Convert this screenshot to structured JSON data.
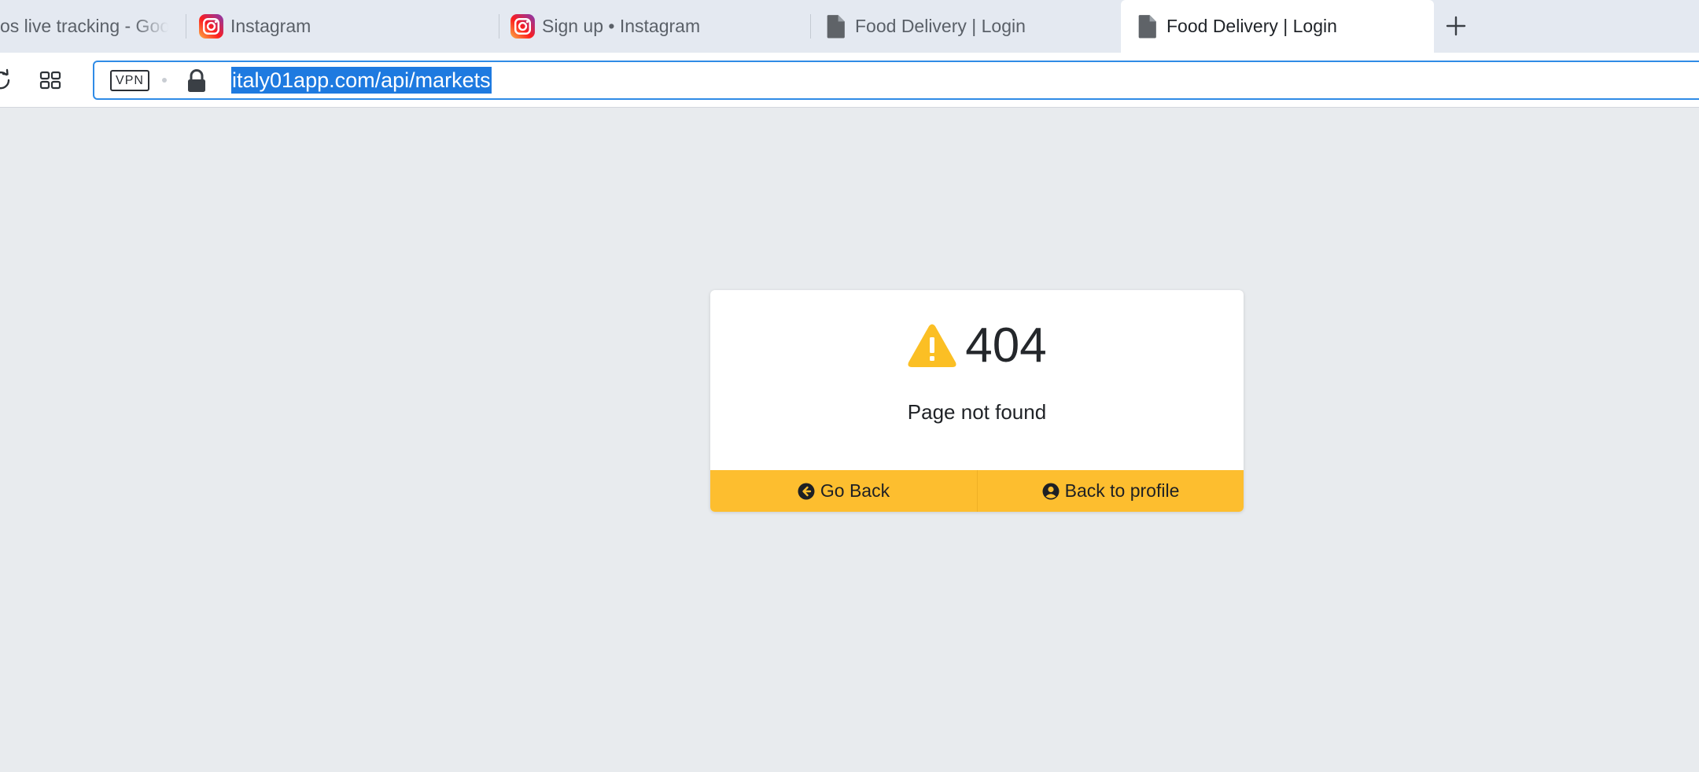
{
  "browser": {
    "tabs": [
      {
        "label": "os live tracking - Goog",
        "icon": "none",
        "active": false
      },
      {
        "label": "Instagram",
        "icon": "instagram-icon",
        "active": false
      },
      {
        "label": "Sign up • Instagram",
        "icon": "instagram-icon",
        "active": false
      },
      {
        "label": "Food Delivery | Login",
        "icon": "document-icon",
        "active": false
      },
      {
        "label": "Food Delivery | Login",
        "icon": "document-icon",
        "active": true
      }
    ],
    "new_tab_icon": "plus-icon",
    "toolbar": {
      "reload_icon": "reload-icon",
      "tabs_grid_icon": "grid-icon",
      "vpn_label": "VPN",
      "lock_icon": "lock-icon",
      "url": "italy01app.com/api/markets"
    },
    "colors": {
      "url_selection": "#1e7ae0",
      "url_focus_border": "#2f8be6"
    }
  },
  "page": {
    "error_card": {
      "icon": "warning-icon",
      "code": "404",
      "message": "Page not found",
      "actions": [
        {
          "label": "Go Back",
          "icon": "arrow-circle-left-icon"
        },
        {
          "label": "Back to profile",
          "icon": "user-circle-icon"
        }
      ]
    },
    "colors": {
      "accent": "#fdbe2f",
      "warning": "#fbbf24",
      "background": "#e8ebee"
    }
  }
}
